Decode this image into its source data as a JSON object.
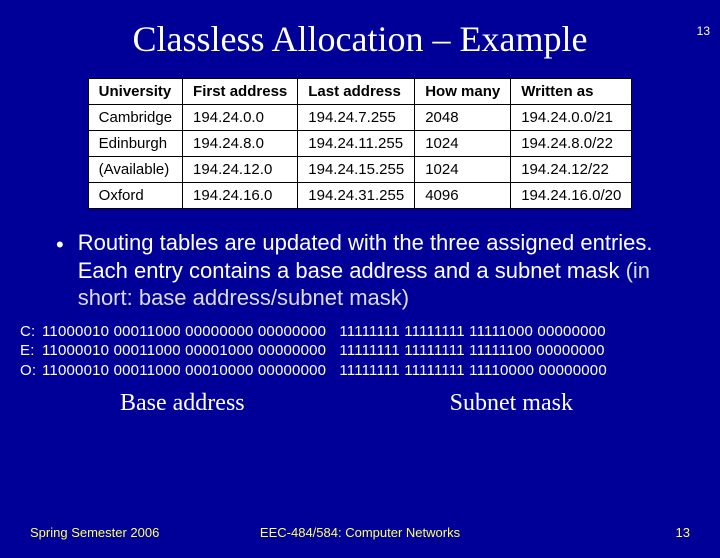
{
  "page_number_top": "13",
  "title": "Classless Allocation – Example",
  "table": {
    "headers": [
      "University",
      "First address",
      "Last address",
      "How many",
      "Written as"
    ],
    "rows": [
      [
        "Cambridge",
        "194.24.0.0",
        "194.24.7.255",
        "2048",
        "194.24.0.0/21"
      ],
      [
        "Edinburgh",
        "194.24.8.0",
        "194.24.11.255",
        "1024",
        "194.24.8.0/22"
      ],
      [
        "(Available)",
        "194.24.12.0",
        "194.24.15.255",
        "1024",
        "194.24.12/22"
      ],
      [
        "Oxford",
        "194.24.16.0",
        "194.24.31.255",
        "4096",
        "194.24.16.0/20"
      ]
    ]
  },
  "bullet": {
    "dot": "•",
    "main": "Routing tables are updated with the three assigned entries. Each entry contains a base address and a subnet mask ",
    "paren": "(in short: base address/subnet mask)"
  },
  "binary": [
    {
      "label": "C:",
      "base": "11000010 00011000 00000000 00000000",
      "mask": "11111111 11111111 11111000 00000000"
    },
    {
      "label": "E:",
      "base": "11000010 00011000 00001000 00000000",
      "mask": "11111111 11111111 11111100 00000000"
    },
    {
      "label": "O:",
      "base": "11000010 00011000 00010000 00000000",
      "mask": "11111111 11111111 11110000 00000000"
    }
  ],
  "labels": {
    "base": "Base address",
    "mask": "Subnet mask"
  },
  "footer": {
    "left": "Spring Semester 2006",
    "center": "EEC-484/584: Computer Networks",
    "right": "13"
  }
}
